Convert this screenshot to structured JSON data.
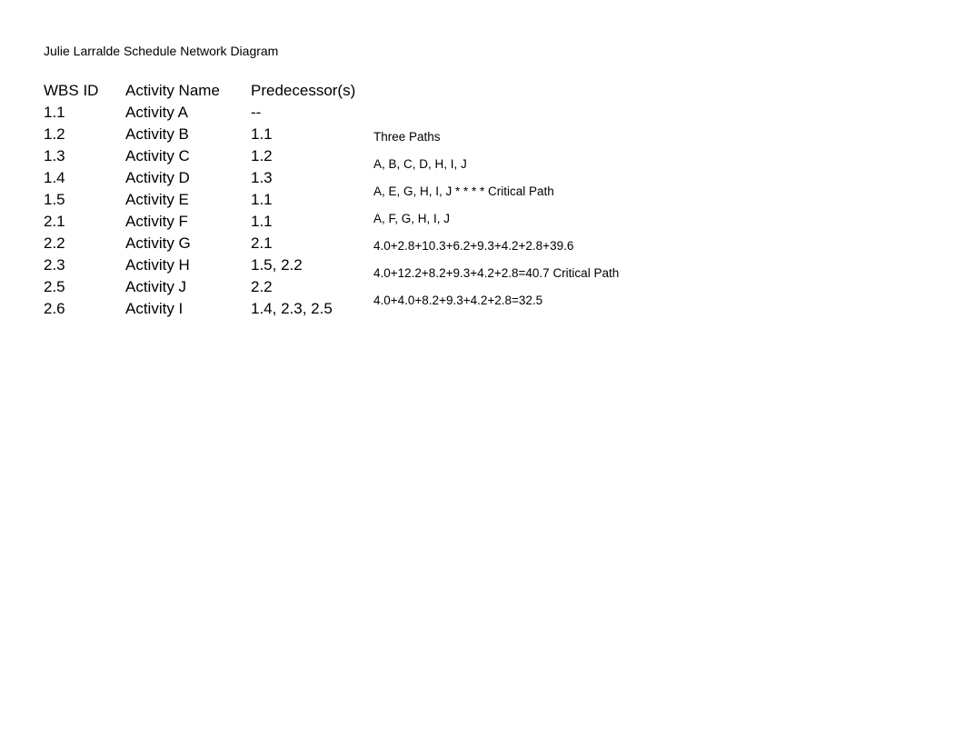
{
  "title": "Julie Larralde Schedule Network Diagram",
  "table": {
    "headers": {
      "wbs": "WBS ID",
      "name": "Activity Name",
      "pred": "Predecessor(s)"
    },
    "rows": [
      {
        "wbs": "1.1",
        "name": "Activity A",
        "pred": "--"
      },
      {
        "wbs": "1.2",
        "name": "Activity B",
        "pred": "1.1"
      },
      {
        "wbs": "1.3",
        "name": "Activity C",
        "pred": "1.2"
      },
      {
        "wbs": "1.4",
        "name": "Activity D",
        "pred": "1.3"
      },
      {
        "wbs": "1.5",
        "name": "Activity E",
        "pred": "1.1"
      },
      {
        "wbs": "2.1",
        "name": "Activity F",
        "pred": "1.1"
      },
      {
        "wbs": "2.2",
        "name": "Activity G",
        "pred": "2.1"
      },
      {
        "wbs": "2.3",
        "name": "Activity H",
        "pred": "1.5, 2.2"
      },
      {
        "wbs": "2.5",
        "name": "Activity J",
        "pred": "2.2"
      },
      {
        "wbs": "2.6",
        "name": "Activity I",
        "pred": "1.4, 2.3, 2.5"
      }
    ]
  },
  "paths": {
    "heading": "Three Paths",
    "lines": [
      "A, B, C, D, H, I, J",
      "A, E, G, H, I, J * * * * Critical Path",
      "A, F, G, H, I, J",
      "4.0+2.8+10.3+6.2+9.3+4.2+2.8+39.6",
      "4.0+12.2+8.2+9.3+4.2+2.8=40.7 Critical Path",
      "4.0+4.0+8.2+9.3+4.2+2.8=32.5"
    ]
  }
}
